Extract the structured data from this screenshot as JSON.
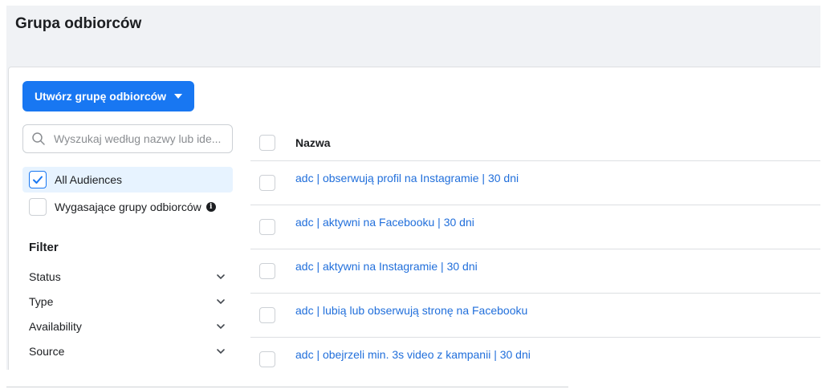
{
  "page": {
    "title": "Grupa odbiorców"
  },
  "toolbar": {
    "create_label": "Utwórz grupę odbiorców"
  },
  "search": {
    "placeholder": "Wyszukaj według nazwy lub ide..."
  },
  "audiences": {
    "all_label": "All Audiences",
    "expiring_label": "Wygasające grupy odbiorców"
  },
  "filter": {
    "title": "Filter",
    "items": [
      "Status",
      "Type",
      "Availability",
      "Source"
    ]
  },
  "table": {
    "header": "Nazwa",
    "rows": [
      "adc | obserwują profil na Instagramie | 30 dni",
      "adc | aktywni na Facebooku | 30 dni",
      "adc | aktywni na Instagramie | 30 dni",
      "adc | lubią lub obserwują stronę na Facebooku",
      "adc | obejrzeli min. 3s video z kampanii | 30 dni"
    ]
  },
  "colors": {
    "accent": "#1877f2",
    "link": "#216fdb",
    "background": "#f0f2f5"
  }
}
